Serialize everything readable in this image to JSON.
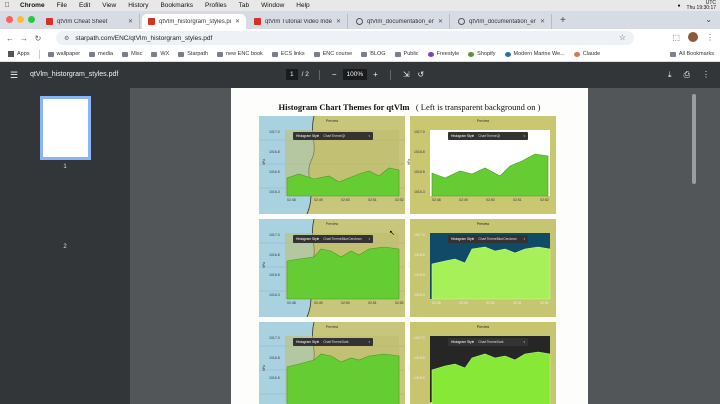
{
  "menubar": {
    "app": "Chrome",
    "items": [
      "File",
      "Edit",
      "View",
      "History",
      "Bookmarks",
      "Profiles",
      "Tab",
      "Window",
      "Help"
    ],
    "clock_tz": "UTC",
    "clock_time": "Thu 19:30:17"
  },
  "tabs": [
    {
      "title": "qtVlm Cheat Sheet",
      "favicon": "red-doc"
    },
    {
      "title": "qtVlm_historgram_styles.pdf",
      "favicon": "red-doc"
    },
    {
      "title": "qtVlm Tutorial Video Index",
      "favicon": "red-doc"
    },
    {
      "title": "qtVlm_documentation_en.pd",
      "favicon": "github"
    },
    {
      "title": "qtVlm_documentation_en.pd",
      "favicon": "github"
    }
  ],
  "toolbar": {
    "url": "starpath.com/ENC/qtVlm_historgram_styles.pdf"
  },
  "bookmarks": {
    "items": [
      "Apps",
      "wallpaper",
      "media",
      "Misc",
      "WX",
      "Starpath",
      "new ENC book",
      "ECS links",
      "ENC course",
      "BLOG",
      "Public",
      "Freestyle",
      "Shopify",
      "Modern Marine We...",
      "Claude"
    ],
    "all_label": "All Bookmarks"
  },
  "pdf": {
    "filename": "qtVlm_historgram_styles.pdf",
    "page_current": "1",
    "page_total": "/ 2",
    "zoom": "100%",
    "thumbs": [
      "1",
      "2"
    ]
  },
  "doc": {
    "title_bold": "Histogram Chart Themes for qtVlm",
    "title_note": "( Left is transparent background on )",
    "cards": [
      {
        "preview": "Preview",
        "style_label": "Histogram Style",
        "style_value": "ChartThemeQt",
        "yticks": [
          "1017.0",
          "1016.8",
          "1016.5",
          "1016.3"
        ],
        "xticks": [
          "02:48",
          "02:49",
          "02:50",
          "02:51",
          "02:52"
        ],
        "ylabel": "hPa"
      },
      {
        "preview": "Preview",
        "style_label": "Histogram Style",
        "style_value": "ChartThemeQt",
        "yticks": [
          "1017.0",
          "1016.8",
          "1016.5",
          "1016.3"
        ],
        "xticks": [
          "02:48",
          "02:49",
          "02:50",
          "02:51",
          "02:52"
        ],
        "ylabel": "hPa"
      },
      {
        "preview": "Preview",
        "style_label": "Histogram Style",
        "style_value": "ChartThemeBlueCerulean",
        "yticks": [
          "1017.0",
          "1016.8",
          "1016.5",
          "1016.3"
        ],
        "xticks": [
          "02:48",
          "02:49",
          "02:50",
          "02:51",
          "02:52"
        ],
        "ylabel": "hPa"
      },
      {
        "preview": "Preview",
        "style_label": "Histogram Style",
        "style_value": "ChartThemeBlueCerulean",
        "yticks": [
          "1017.0",
          "1016.8",
          "1016.5",
          "1016.3"
        ],
        "xticks": [
          "02:48",
          "02:49",
          "02:50",
          "02:51",
          "02:52"
        ],
        "ylabel": "hPa"
      },
      {
        "preview": "Preview",
        "style_label": "Histogram Style",
        "style_value": "ChartThemeDark",
        "yticks": [
          "1017.0",
          "1016.8",
          "1016.5"
        ],
        "xticks": [],
        "ylabel": "hPa"
      },
      {
        "preview": "Preview",
        "style_label": "Histogram Style",
        "style_value": "ChartThemeDark",
        "yticks": [
          "1017.0",
          "1016.8",
          "1016.5"
        ],
        "xticks": [],
        "ylabel": "hPa"
      }
    ]
  },
  "colors": {
    "tabstrip": "#d7dbe4",
    "pdf_header": "#323639",
    "doc_bg": "#525659",
    "thumb_border": "#8ab4f8",
    "accent_red": "#d93025"
  }
}
